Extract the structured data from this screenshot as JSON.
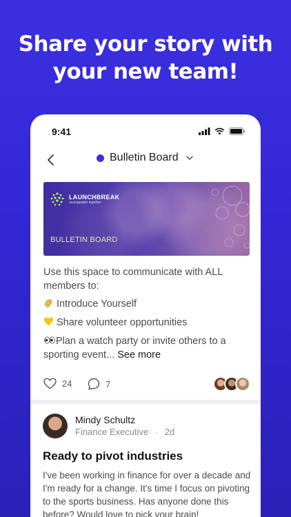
{
  "headline": {
    "line1": "Share your story with",
    "line2": "your new team!"
  },
  "status_bar": {
    "time": "9:41"
  },
  "nav": {
    "title": "Bulletin Board"
  },
  "banner": {
    "brand": "LAUNCHBREAK",
    "tagline": "unstoppable together",
    "label": "BULLETIN BOARD"
  },
  "post_body": {
    "intro": "Use this space to communicate with ALL members to:",
    "item1": "Introduce Yourself",
    "item2": "Share volunteer opportunities",
    "item3": "Plan a watch party or invite others to a sporting event...",
    "see_more": "See more"
  },
  "stats": {
    "likes": "24",
    "comments": "7"
  },
  "post": {
    "author": "Mindy Schultz",
    "role": "Finance Executive",
    "time": "2d",
    "title": "Ready to pivot industries",
    "body": "I've been working in finance for over a decade and I'm ready for a change. It's time I focus on pivoting to the sports business. Has anyone done this before? Would love to pick your brain!"
  },
  "colors": {
    "accent": "#3b2fe0",
    "background": "#3327d6"
  }
}
